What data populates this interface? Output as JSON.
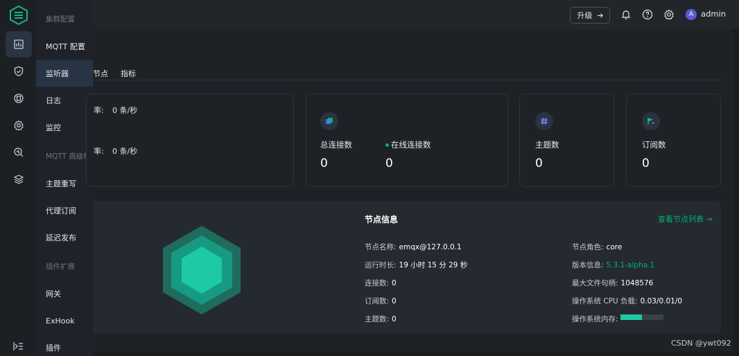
{
  "header": {
    "upgrade_label": "升级",
    "user_avatar_letter": "A",
    "user_name": "admin"
  },
  "rail": {
    "icons": [
      "logo-icon",
      "dashboard-icon",
      "shield-icon",
      "management-icon",
      "settings-icon",
      "diagnose-icon",
      "layers-icon"
    ],
    "active_index": 1
  },
  "submenu": {
    "items": [
      {
        "label": "集群配置",
        "type": "group"
      },
      {
        "label": "MQTT 配置",
        "type": "item"
      },
      {
        "label": "监听器",
        "type": "item",
        "active": true
      },
      {
        "label": "日志",
        "type": "item"
      },
      {
        "label": "监控",
        "type": "item"
      },
      {
        "label": "MQTT 高级特性",
        "type": "group"
      },
      {
        "label": "主题重写",
        "type": "item"
      },
      {
        "label": "代理订阅",
        "type": "item"
      },
      {
        "label": "延迟发布",
        "type": "item"
      },
      {
        "label": "插件扩展",
        "type": "group"
      },
      {
        "label": "网关",
        "type": "item"
      },
      {
        "label": "ExHook",
        "type": "item"
      },
      {
        "label": "插件",
        "type": "item"
      }
    ]
  },
  "tabs": {
    "nodes_partial": "节点",
    "metrics": "指标"
  },
  "rates": {
    "row1_label_partial": "率:",
    "row1_value": "0 条/秒",
    "row2_label_partial": "率:",
    "row2_value": "0 条/秒"
  },
  "metrics": {
    "total_connections_label": "总连接数",
    "total_connections_value": "0",
    "online_connections_label": "在线连接数",
    "online_connections_value": "0",
    "topics_label": "主题数",
    "topics_value": "0",
    "subscriptions_label": "订阅数",
    "subscriptions_value": "0"
  },
  "node_info": {
    "title": "节点信息",
    "view_list_link": "查看节点列表 →",
    "left": [
      {
        "key": "节点名称:",
        "value": "emqx@127.0.0.1"
      },
      {
        "key": "运行时长:",
        "value": "19 小时 15 分 29 秒"
      },
      {
        "key": "连接数:",
        "value": "0"
      },
      {
        "key": "订阅数:",
        "value": "0"
      },
      {
        "key": "主题数:",
        "value": "0"
      }
    ],
    "right": [
      {
        "key": "节点角色:",
        "value": "core"
      },
      {
        "key": "版本信息:",
        "value": "5.3.1-alpha.1"
      },
      {
        "key": "最大文件句柄:",
        "value": "1048576"
      },
      {
        "key": "操作系统 CPU 负载:",
        "value": "0.03/0.01/0"
      },
      {
        "key": "操作系统内存:",
        "value": ""
      }
    ],
    "memory_usage_fraction": 0.5
  },
  "colors": {
    "accent": "#00b173",
    "hex_outer": "#1f6b5e",
    "hex_mid": "#169a82",
    "hex_inner": "#1ec9a5"
  },
  "watermark": "CSDN @ywt092"
}
